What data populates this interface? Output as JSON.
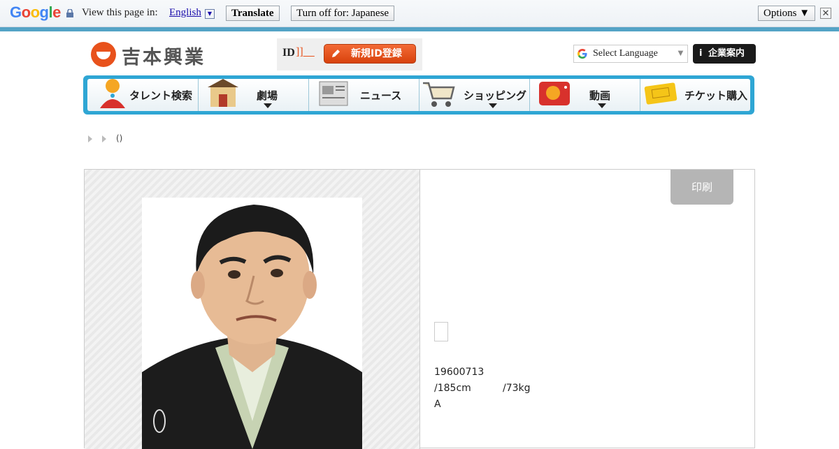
{
  "translate_bar": {
    "logo": "Google",
    "prompt": "View this page in:",
    "language": "English",
    "translate_label": "Translate",
    "turn_off_label": "Turn off for: Japanese",
    "options_label": "Options ▼",
    "close_label": "✕"
  },
  "header": {
    "logo_text": "吉本興業",
    "id_label": "ID",
    "id_link": "]]__",
    "register_label": "新規ID登録",
    "select_language": "Select Language",
    "select_arrow": "▼",
    "corporate_label": "企業案内",
    "corporate_icon_glyph": "i"
  },
  "nav": {
    "items": [
      {
        "label": "タレント検索",
        "icon": "talent-icon",
        "has_dropdown": false
      },
      {
        "label": "劇場",
        "icon": "theater-icon",
        "has_dropdown": true
      },
      {
        "label": "ニュース",
        "icon": "news-icon",
        "has_dropdown": false
      },
      {
        "label": "ショッピング",
        "icon": "shopping-cart-icon",
        "has_dropdown": true
      },
      {
        "label": "動画",
        "icon": "tv-icon",
        "has_dropdown": true
      },
      {
        "label": "チケット購入",
        "icon": "ticket-icon",
        "has_dropdown": false
      }
    ]
  },
  "breadcrumb": {
    "current": "()"
  },
  "profile": {
    "print_label": "印刷",
    "birthdate": "19600713",
    "height": "/185cm",
    "weight": "/73kg",
    "blood_type": "A"
  },
  "colors": {
    "brand_orange": "#e8521c",
    "nav_blue": "#2fa6d4",
    "translate_stripe": "#54a3c6"
  }
}
